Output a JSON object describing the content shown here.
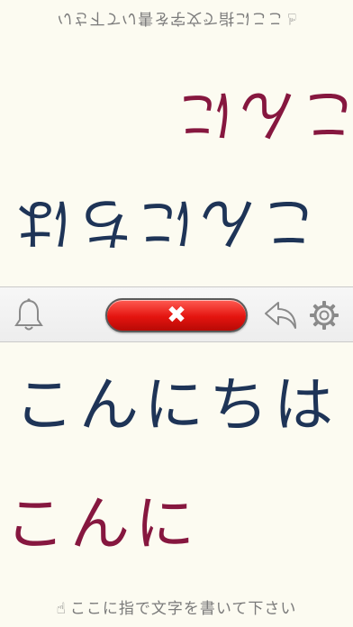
{
  "top_pad": {
    "hint": "ここに指で文字を書いて下さい",
    "hint_icon": "pointing-finger-icon",
    "ink_lines": [
      {
        "text": "こんにちは",
        "color": "#1e3457"
      },
      {
        "text": "こんに",
        "color": "#86173f"
      }
    ]
  },
  "toolbar": {
    "bell_icon": "bell-icon",
    "clear_icon": "close-icon",
    "clear_symbol": "✖",
    "undo_icon": "undo-arrow-icon",
    "settings_icon": "gear-icon"
  },
  "bottom_pad": {
    "hint": "ここに指で文字を書いて下さい",
    "hint_icon": "pointing-finger-icon",
    "ink_lines": [
      {
        "text": "こんにちは",
        "color": "#1e3457"
      },
      {
        "text": "こんに",
        "color": "#86173f"
      }
    ]
  },
  "colors": {
    "paper": "#fcfbf1",
    "clear_button": "#e4140f",
    "ink_navy": "#1e3457",
    "ink_maroon": "#86173f"
  }
}
